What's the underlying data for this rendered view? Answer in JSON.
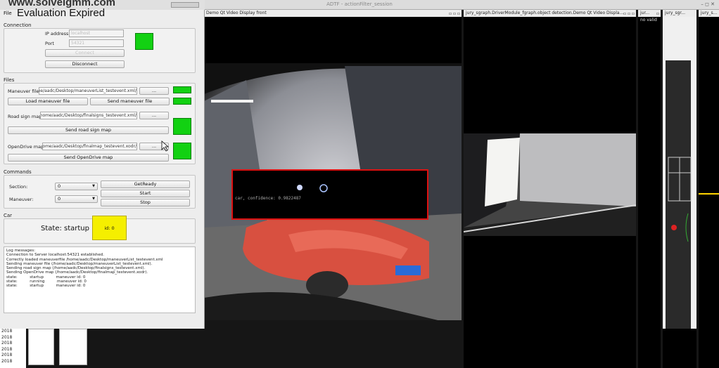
{
  "desktop": {
    "title": "ADTF - actionFilter_session",
    "window_controls": "– ◻ ✕"
  },
  "watermark": "www.solveigmm.com",
  "qt_window": {
    "title_text": "Evaluation Expired",
    "menu_file": "File",
    "connection": {
      "group": "Connection",
      "ip_label": "IP address",
      "ip_value": "localhost",
      "port_label": "Port",
      "port_value": "54321",
      "connect_label": "Connect",
      "disconnect_label": "Disconnect",
      "status_color": "#12d112"
    },
    "files": {
      "group": "Files",
      "maneuver_label": "Maneuver file",
      "maneuver_path": "/home/aadc/Desktop/maneuverList_testevent.xml",
      "browse": "...",
      "load_maneuver": "Load maneuver file",
      "send_maneuver": "Send maneuver file",
      "roadsign_label": "Road sign map",
      "roadsign_path": "/home/aadc/Desktop/finalsigns_testevent.xml",
      "send_roadsign": "Send road sign map",
      "opendrive_label": "OpenDrive map",
      "opendrive_path": "/home/aadc/Desktop/finalmap_testevent.xodr",
      "send_opendrive": "Send OpenDrive map"
    },
    "commands": {
      "group": "Commands",
      "section_label": "Section:",
      "section_value": "0",
      "maneuver_label": "Maneuver:",
      "maneuver_value": "0",
      "getready": "GetReady",
      "start": "Start",
      "stop": "Stop"
    },
    "car": {
      "group": "Car",
      "state": "State: startup",
      "id": "id: 0",
      "id_color": "#f5ef00"
    },
    "log": {
      "lines": [
        "Log messages:",
        "Connection to Server localhost:54321 established.",
        "Correctly loaded maneuverfile /home/aadc/Desktop/maneuverList_testevent.xml",
        "Sending maneuver file (/home/aadc/Desktop/maneuverList_testevent.xml).",
        "Sending road sign map (/home/aadc/Desktop/finalsigns_testevent.xml).",
        "Sending OpenDrive map (/home/aadc/Desktop/finalmap_testevent.xodr).",
        "state:          startup          maneuver id: 0",
        "state:          running          maneuver id: 0",
        "state:          startup          maneuver id: 0"
      ]
    }
  },
  "tree_items": [
    "2018",
    "2018",
    "2018",
    "2018",
    "2018",
    "2018"
  ],
  "panels": {
    "front": {
      "title": "Demo Qt Video Display front",
      "overlay_text": "car, confidence: 0.9822487",
      "box_color": "#dd1111"
    },
    "object_detection": {
      "title": "jury_sgraph.DriverModule_fgraph.object detection.Demo Qt Video Displa..."
    },
    "jury1": {
      "title": "jur...",
      "text": "no valid"
    },
    "jury2": {
      "title": "jury_sgr..."
    },
    "jury3": {
      "title": "jury_s..."
    }
  },
  "icons": [
    "window-buttons-icon",
    "cursor-icon",
    "dropdown-arrow-icon"
  ]
}
